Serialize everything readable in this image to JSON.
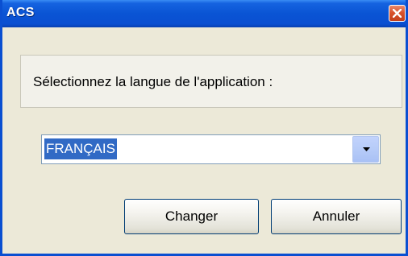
{
  "window": {
    "title": "ACS"
  },
  "prompt": {
    "label": "Sélectionnez la langue de l'application :"
  },
  "language_select": {
    "selected_value": "FRANÇAIS"
  },
  "buttons": {
    "change_label": "Changer",
    "cancel_label": "Annuler"
  },
  "icons": {
    "close": "close-icon",
    "dropdown": "chevron-down-icon"
  },
  "colors": {
    "titlebar": "#0a4fd1",
    "selection_highlight": "#316ac5",
    "close_button": "#d9542e"
  }
}
